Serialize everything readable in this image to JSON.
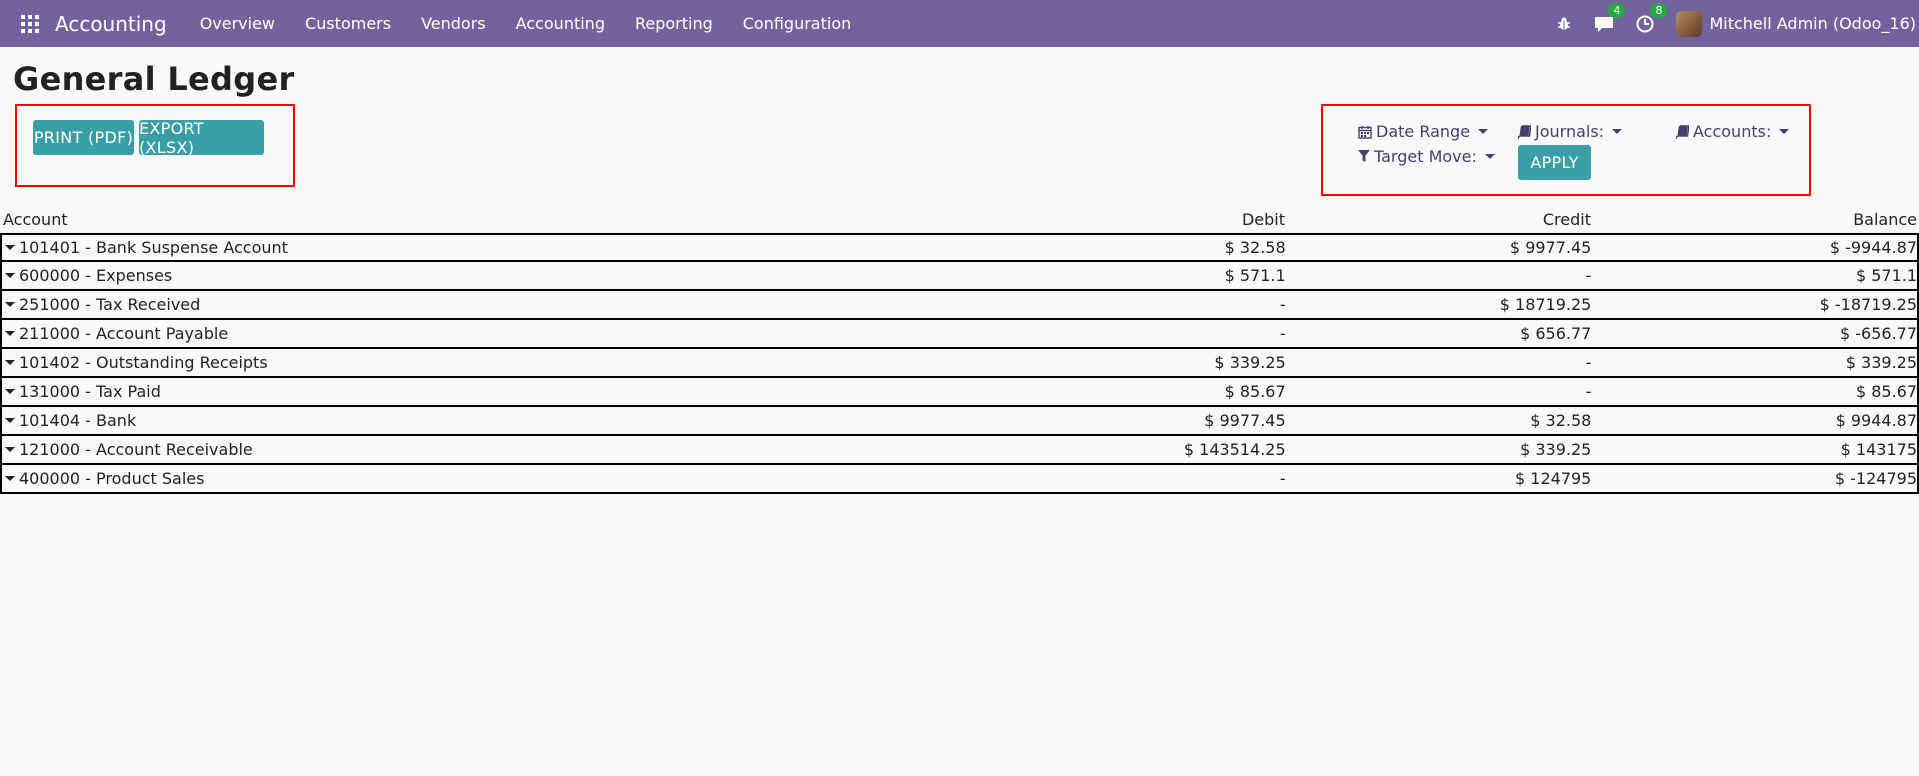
{
  "navbar": {
    "brand": "Accounting",
    "menu": [
      "Overview",
      "Customers",
      "Vendors",
      "Accounting",
      "Reporting",
      "Configuration"
    ],
    "messages_count": "4",
    "activities_count": "8",
    "user": "Mitchell Admin (Odoo_16)"
  },
  "page": {
    "title": "General Ledger",
    "print_label": "PRINT (PDF)",
    "export_label": "EXPORT (XLSX)"
  },
  "filters": {
    "date_range": "Date Range",
    "journals": "Journals:",
    "accounts": "Accounts:",
    "target_move": "Target Move:",
    "apply": "APPLY"
  },
  "table": {
    "headers": {
      "account": "Account",
      "debit": "Debit",
      "credit": "Credit",
      "balance": "Balance"
    },
    "rows": [
      {
        "account": "101401 - Bank Suspense Account",
        "debit": "$ 32.58",
        "credit": "$ 9977.45",
        "balance": "$ -9944.87"
      },
      {
        "account": "600000 - Expenses",
        "debit": "$ 571.1",
        "credit": "-",
        "balance": "$ 571.1"
      },
      {
        "account": "251000 - Tax Received",
        "debit": "-",
        "credit": "$ 18719.25",
        "balance": "$ -18719.25"
      },
      {
        "account": "211000 - Account Payable",
        "debit": "-",
        "credit": "$ 656.77",
        "balance": "$ -656.77"
      },
      {
        "account": "101402 - Outstanding Receipts",
        "debit": "$ 339.25",
        "credit": "-",
        "balance": "$ 339.25"
      },
      {
        "account": "131000 - Tax Paid",
        "debit": "$ 85.67",
        "credit": "-",
        "balance": "$ 85.67"
      },
      {
        "account": "101404 - Bank",
        "debit": "$ 9977.45",
        "credit": "$ 32.58",
        "balance": "$ 9944.87"
      },
      {
        "account": "121000 - Account Receivable",
        "debit": "$ 143514.25",
        "credit": "$ 339.25",
        "balance": "$ 143175"
      },
      {
        "account": "400000 - Product Sales",
        "debit": "-",
        "credit": "$ 124795",
        "balance": "$ -124795"
      }
    ]
  }
}
